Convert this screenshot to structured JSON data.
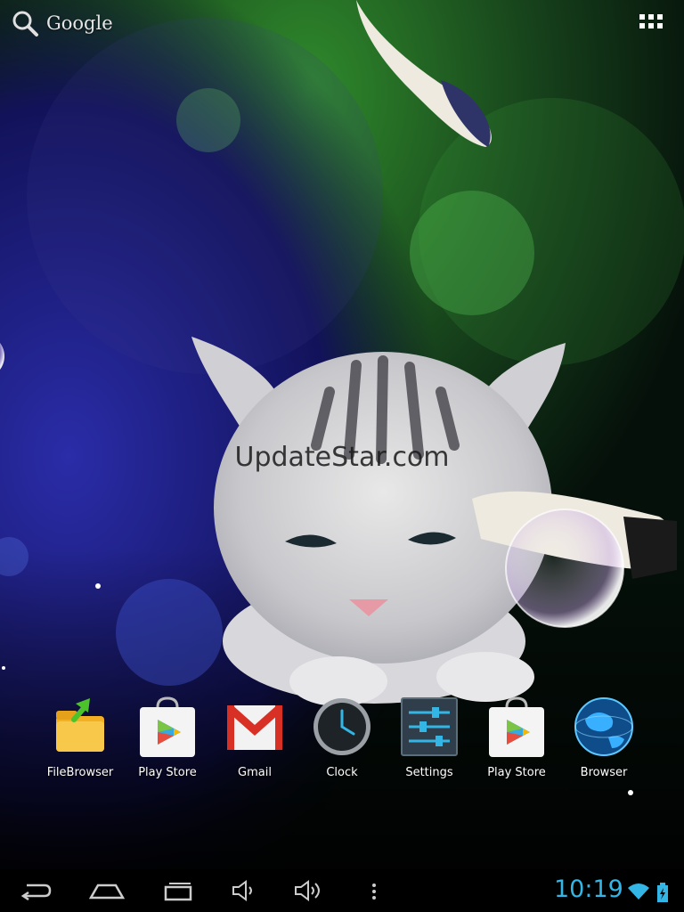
{
  "search": {
    "label": "Google",
    "icon": "search-icon"
  },
  "app_drawer": {
    "icon": "all-apps-grid-icon"
  },
  "watermark": "UpdateStar.com",
  "dock": [
    {
      "label": "FileBrowser",
      "icon": "folder-icon"
    },
    {
      "label": "Play Store",
      "icon": "play-store-icon"
    },
    {
      "label": "Gmail",
      "icon": "gmail-icon"
    },
    {
      "label": "Clock",
      "icon": "clock-icon"
    },
    {
      "label": "Settings",
      "icon": "settings-sliders-icon"
    },
    {
      "label": "Play Store",
      "icon": "play-store-icon"
    },
    {
      "label": "Browser",
      "icon": "globe-icon"
    }
  ],
  "nav": [
    "back-icon",
    "home-icon",
    "recent-apps-icon",
    "volume-down-icon",
    "volume-up-icon",
    "menu-icon"
  ],
  "status": {
    "time": "10:19",
    "accent": "#33b5e5"
  }
}
